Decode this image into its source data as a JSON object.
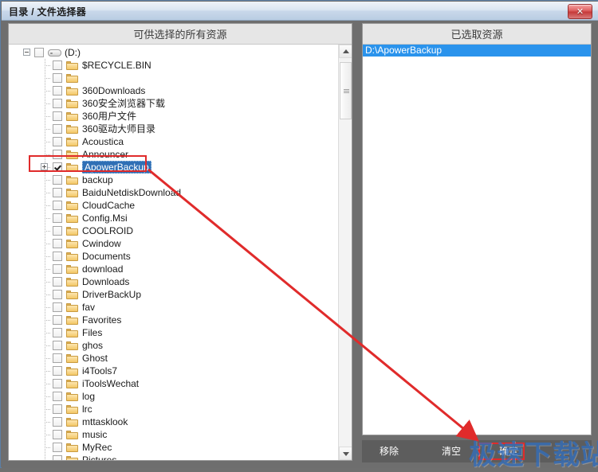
{
  "window": {
    "title": "目录 / 文件选择器",
    "close_label": "✕"
  },
  "left_panel": {
    "header": "可供选择的所有资源",
    "root": {
      "label": "(D:)",
      "expander": "minus",
      "checked": false,
      "icon": "drive-icon"
    },
    "items": [
      {
        "label": "$RECYCLE.BIN",
        "checked": false,
        "expandable": false
      },
      {
        "label": "",
        "checked": false,
        "expandable": false
      },
      {
        "label": "360Downloads",
        "checked": false,
        "expandable": false
      },
      {
        "label": "360安全浏览器下载",
        "checked": false,
        "expandable": false
      },
      {
        "label": "360用户文件",
        "checked": false,
        "expandable": false
      },
      {
        "label": "360驱动大师目录",
        "checked": false,
        "expandable": false
      },
      {
        "label": "Acoustica",
        "checked": false,
        "expandable": false
      },
      {
        "label": "Announcer",
        "checked": false,
        "expandable": false
      },
      {
        "label": "ApowerBackup",
        "checked": true,
        "expandable": true,
        "selected": true
      },
      {
        "label": "backup",
        "checked": false,
        "expandable": false
      },
      {
        "label": "BaiduNetdiskDownload",
        "checked": false,
        "expandable": false
      },
      {
        "label": "CloudCache",
        "checked": false,
        "expandable": false
      },
      {
        "label": "Config.Msi",
        "checked": false,
        "expandable": false
      },
      {
        "label": "COOLROID",
        "checked": false,
        "expandable": false
      },
      {
        "label": "Cwindow",
        "checked": false,
        "expandable": false
      },
      {
        "label": "Documents",
        "checked": false,
        "expandable": false
      },
      {
        "label": "download",
        "checked": false,
        "expandable": false
      },
      {
        "label": "Downloads",
        "checked": false,
        "expandable": false
      },
      {
        "label": "DriverBackUp",
        "checked": false,
        "expandable": false
      },
      {
        "label": "fav",
        "checked": false,
        "expandable": false
      },
      {
        "label": "Favorites",
        "checked": false,
        "expandable": false
      },
      {
        "label": "Files",
        "checked": false,
        "expandable": false
      },
      {
        "label": "ghos",
        "checked": false,
        "expandable": false
      },
      {
        "label": "Ghost",
        "checked": false,
        "expandable": false
      },
      {
        "label": "i4Tools7",
        "checked": false,
        "expandable": false
      },
      {
        "label": "iToolsWechat",
        "checked": false,
        "expandable": false
      },
      {
        "label": "log",
        "checked": false,
        "expandable": false
      },
      {
        "label": "lrc",
        "checked": false,
        "expandable": false
      },
      {
        "label": "mttasklook",
        "checked": false,
        "expandable": false
      },
      {
        "label": "music",
        "checked": false,
        "expandable": false
      },
      {
        "label": "MyRec",
        "checked": false,
        "expandable": false
      },
      {
        "label": "Pictures",
        "checked": false,
        "expandable": false
      }
    ],
    "scrollbar": {
      "up_icon": "scroll-up-arrow",
      "down_icon": "scroll-down-arrow"
    }
  },
  "right_panel": {
    "header": "已选取资源",
    "items": [
      {
        "label": "D:\\ApowerBackup",
        "selected": true
      }
    ]
  },
  "bottom_bar": {
    "remove_label": "移除",
    "clear_label": "清空",
    "confirm_label": "确定"
  },
  "watermark": {
    "text": "极速下载站"
  },
  "colors": {
    "selection_blue": "#2a93ec",
    "tree_selection": "#2f6fb5",
    "annotation_red": "#e02b2b",
    "bottom_bar": "#5d5d5d",
    "watermark_blue": "#2f6fc4"
  }
}
